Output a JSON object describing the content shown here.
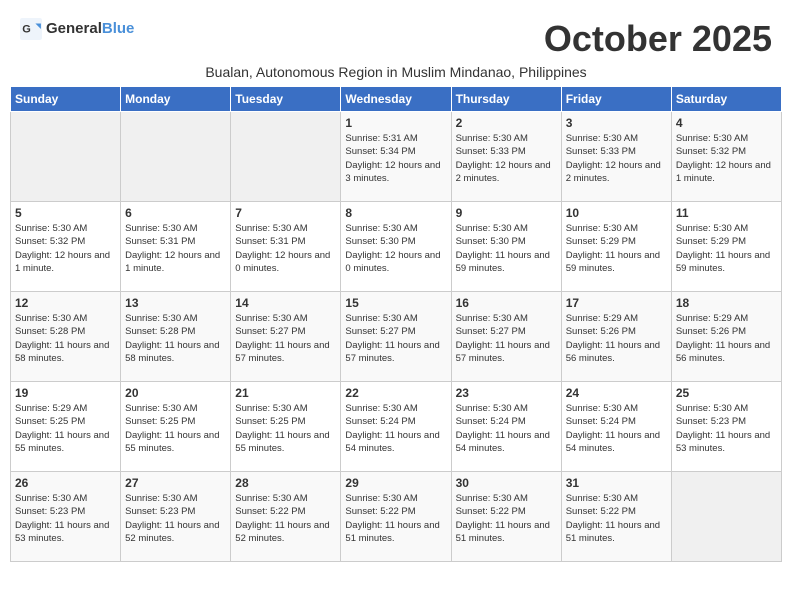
{
  "header": {
    "logo_general": "General",
    "logo_blue": "Blue",
    "month_title": "October 2025",
    "subtitle": "Bualan, Autonomous Region in Muslim Mindanao, Philippines"
  },
  "days_of_week": [
    "Sunday",
    "Monday",
    "Tuesday",
    "Wednesday",
    "Thursday",
    "Friday",
    "Saturday"
  ],
  "weeks": [
    [
      {
        "day": "",
        "info": ""
      },
      {
        "day": "",
        "info": ""
      },
      {
        "day": "",
        "info": ""
      },
      {
        "day": "1",
        "info": "Sunrise: 5:31 AM\nSunset: 5:34 PM\nDaylight: 12 hours and 3 minutes."
      },
      {
        "day": "2",
        "info": "Sunrise: 5:30 AM\nSunset: 5:33 PM\nDaylight: 12 hours and 2 minutes."
      },
      {
        "day": "3",
        "info": "Sunrise: 5:30 AM\nSunset: 5:33 PM\nDaylight: 12 hours and 2 minutes."
      },
      {
        "day": "4",
        "info": "Sunrise: 5:30 AM\nSunset: 5:32 PM\nDaylight: 12 hours and 1 minute."
      }
    ],
    [
      {
        "day": "5",
        "info": "Sunrise: 5:30 AM\nSunset: 5:32 PM\nDaylight: 12 hours and 1 minute."
      },
      {
        "day": "6",
        "info": "Sunrise: 5:30 AM\nSunset: 5:31 PM\nDaylight: 12 hours and 1 minute."
      },
      {
        "day": "7",
        "info": "Sunrise: 5:30 AM\nSunset: 5:31 PM\nDaylight: 12 hours and 0 minutes."
      },
      {
        "day": "8",
        "info": "Sunrise: 5:30 AM\nSunset: 5:30 PM\nDaylight: 12 hours and 0 minutes."
      },
      {
        "day": "9",
        "info": "Sunrise: 5:30 AM\nSunset: 5:30 PM\nDaylight: 11 hours and 59 minutes."
      },
      {
        "day": "10",
        "info": "Sunrise: 5:30 AM\nSunset: 5:29 PM\nDaylight: 11 hours and 59 minutes."
      },
      {
        "day": "11",
        "info": "Sunrise: 5:30 AM\nSunset: 5:29 PM\nDaylight: 11 hours and 59 minutes."
      }
    ],
    [
      {
        "day": "12",
        "info": "Sunrise: 5:30 AM\nSunset: 5:28 PM\nDaylight: 11 hours and 58 minutes."
      },
      {
        "day": "13",
        "info": "Sunrise: 5:30 AM\nSunset: 5:28 PM\nDaylight: 11 hours and 58 minutes."
      },
      {
        "day": "14",
        "info": "Sunrise: 5:30 AM\nSunset: 5:27 PM\nDaylight: 11 hours and 57 minutes."
      },
      {
        "day": "15",
        "info": "Sunrise: 5:30 AM\nSunset: 5:27 PM\nDaylight: 11 hours and 57 minutes."
      },
      {
        "day": "16",
        "info": "Sunrise: 5:30 AM\nSunset: 5:27 PM\nDaylight: 11 hours and 57 minutes."
      },
      {
        "day": "17",
        "info": "Sunrise: 5:29 AM\nSunset: 5:26 PM\nDaylight: 11 hours and 56 minutes."
      },
      {
        "day": "18",
        "info": "Sunrise: 5:29 AM\nSunset: 5:26 PM\nDaylight: 11 hours and 56 minutes."
      }
    ],
    [
      {
        "day": "19",
        "info": "Sunrise: 5:29 AM\nSunset: 5:25 PM\nDaylight: 11 hours and 55 minutes."
      },
      {
        "day": "20",
        "info": "Sunrise: 5:30 AM\nSunset: 5:25 PM\nDaylight: 11 hours and 55 minutes."
      },
      {
        "day": "21",
        "info": "Sunrise: 5:30 AM\nSunset: 5:25 PM\nDaylight: 11 hours and 55 minutes."
      },
      {
        "day": "22",
        "info": "Sunrise: 5:30 AM\nSunset: 5:24 PM\nDaylight: 11 hours and 54 minutes."
      },
      {
        "day": "23",
        "info": "Sunrise: 5:30 AM\nSunset: 5:24 PM\nDaylight: 11 hours and 54 minutes."
      },
      {
        "day": "24",
        "info": "Sunrise: 5:30 AM\nSunset: 5:24 PM\nDaylight: 11 hours and 54 minutes."
      },
      {
        "day": "25",
        "info": "Sunrise: 5:30 AM\nSunset: 5:23 PM\nDaylight: 11 hours and 53 minutes."
      }
    ],
    [
      {
        "day": "26",
        "info": "Sunrise: 5:30 AM\nSunset: 5:23 PM\nDaylight: 11 hours and 53 minutes."
      },
      {
        "day": "27",
        "info": "Sunrise: 5:30 AM\nSunset: 5:23 PM\nDaylight: 11 hours and 52 minutes."
      },
      {
        "day": "28",
        "info": "Sunrise: 5:30 AM\nSunset: 5:22 PM\nDaylight: 11 hours and 52 minutes."
      },
      {
        "day": "29",
        "info": "Sunrise: 5:30 AM\nSunset: 5:22 PM\nDaylight: 11 hours and 51 minutes."
      },
      {
        "day": "30",
        "info": "Sunrise: 5:30 AM\nSunset: 5:22 PM\nDaylight: 11 hours and 51 minutes."
      },
      {
        "day": "31",
        "info": "Sunrise: 5:30 AM\nSunset: 5:22 PM\nDaylight: 11 hours and 51 minutes."
      },
      {
        "day": "",
        "info": ""
      }
    ]
  ]
}
